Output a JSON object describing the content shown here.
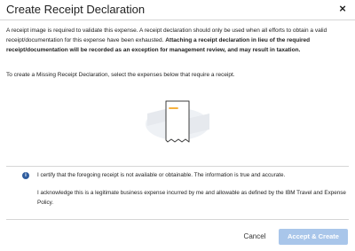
{
  "dialog": {
    "title": "Create Receipt Declaration",
    "close_label": "×"
  },
  "body": {
    "intro_plain": "A receipt image is required to validate this expense. A receipt declaration should only be used when all efforts to obtain a valid receipt/documentation for this expense have been exhausted. ",
    "intro_bold": "Attaching a receipt declaration in lieu of the required receipt/documentation will be recorded as an exception for management review, and may result in taxation.",
    "instruction": "To create a Missing Receipt Declaration, select the expenses below that require a receipt."
  },
  "certification": {
    "info_icon": "i",
    "line1": "I certify that the foregoing receipt is not available or obtainable. The information is true and accurate.",
    "line2": "I acknowledge this is a legitimate business expense incurred by me and allowable as defined by the IBM Travel and Expense Policy."
  },
  "footer": {
    "cancel_label": "Cancel",
    "accept_label": "Accept & Create"
  },
  "colors": {
    "accent_disabled": "#a9c6ea",
    "info_icon": "#2f5d9e",
    "receipt_line": "#f5a623"
  }
}
